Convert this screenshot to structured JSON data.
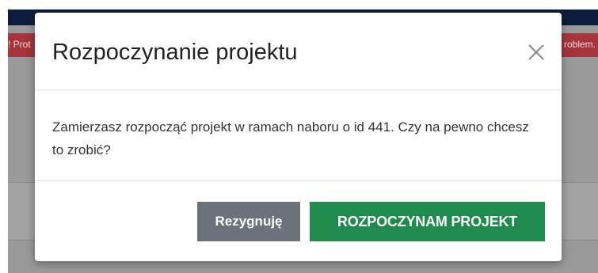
{
  "background": {
    "alert_left": "! Prot",
    "alert_right": "roblem.",
    "alert_color": "#a5343c",
    "topbar_color": "#0f1c3d"
  },
  "modal": {
    "title": "Rozpoczynanie projektu",
    "close_icon": "close-icon",
    "body_text": "Zamierzasz rozpocząć projekt w ramach naboru o id 441. Czy na pewno chcesz to zrobić?",
    "cancel_label": "Rezygnuję",
    "confirm_label": "ROZPOCZYNAM PROJEKT",
    "cancel_color": "#6b727a",
    "confirm_color": "#1e8a4c"
  }
}
